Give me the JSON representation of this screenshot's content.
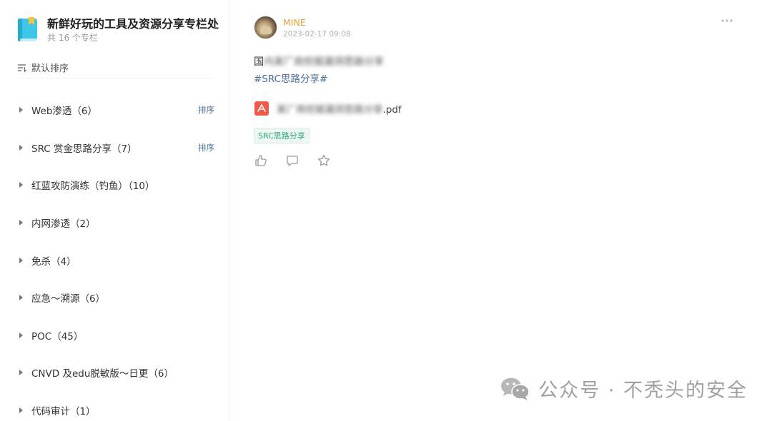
{
  "sidebar": {
    "title": "新鲜好玩的工具及资源分享专栏处",
    "count_text": "共 16 个专栏",
    "sort_label": "默认排序",
    "items": [
      {
        "label": "Web渗透（6）",
        "sort": "排序"
      },
      {
        "label": "SRC 赏金思路分享（7）",
        "sort": "排序"
      },
      {
        "label": "红蓝攻防演练（钓鱼）（10）",
        "sort": ""
      },
      {
        "label": "内网渗透（2）",
        "sort": ""
      },
      {
        "label": "免杀（4）",
        "sort": ""
      },
      {
        "label": "应急～溯源（6）",
        "sort": ""
      },
      {
        "label": "POC（45）",
        "sort": ""
      },
      {
        "label": "CNVD 及edu脱敏版～日更（6）",
        "sort": ""
      },
      {
        "label": "代码审计（1）",
        "sort": ""
      }
    ]
  },
  "post": {
    "author": "MINE",
    "time": "2023-02-17 09:08",
    "text_prefix": "国",
    "text_blurred": "内某厂商挖掘漏洞思路分享",
    "hashtag": "#SRC思路分享#",
    "attachment_blurred": "某厂商挖掘漏洞思路分享",
    "attachment_ext": "pdf",
    "tag": "SRC思路分享",
    "icons": {
      "more": "more-icon",
      "like": "thumb-up-icon",
      "comment": "comment-icon",
      "favorite": "star-icon",
      "attachment": "pdf-icon"
    }
  },
  "watermark": {
    "text": "公众号 · 不秃头的安全"
  },
  "colors": {
    "author": "#e6a23c",
    "link": "#4a6f9a",
    "tag_text": "#2fa87b",
    "pdf": "#f15a4a",
    "book": "#3ec6e8"
  }
}
